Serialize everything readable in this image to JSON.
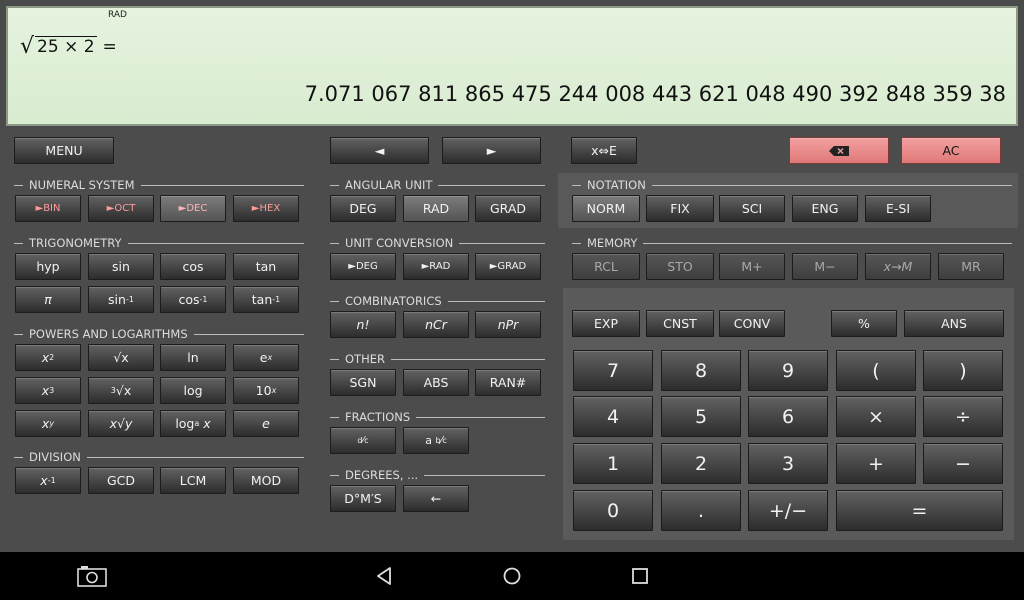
{
  "display": {
    "angle_indicator": "RAD",
    "expression_radicand": "25 × 2",
    "expression_equals": "=",
    "result": "7.071 067 811 865 475 244 008 443 621 048 490 392 848 359 38"
  },
  "top_row": {
    "menu": "MENU",
    "left_arrow": "◄",
    "right_arrow": "►",
    "x_e": "x⇔E",
    "ac": "AC"
  },
  "sections": {
    "numeral_system": "NUMERAL SYSTEM",
    "angular_unit": "ANGULAR UNIT",
    "notation": "NOTATION",
    "trigonometry": "TRIGONOMETRY",
    "unit_conversion": "UNIT CONVERSION",
    "memory": "MEMORY",
    "combinatorics": "COMBINATORICS",
    "powers_logs": "POWERS AND LOGARITHMS",
    "other": "OTHER",
    "fractions": "FRACTIONS",
    "division": "DIVISION",
    "degrees": "DEGREES, ..."
  },
  "numeral": {
    "bin": "►BIN",
    "oct": "►OCT",
    "dec": "►DEC",
    "hex": "►HEX"
  },
  "angular": {
    "deg": "DEG",
    "rad": "RAD",
    "grad": "GRAD"
  },
  "notation": {
    "norm": "NORM",
    "fix": "FIX",
    "sci": "SCI",
    "eng": "ENG",
    "esi": "E-SI"
  },
  "trig": {
    "hyp": "hyp",
    "sin": "sin",
    "cos": "cos",
    "tan": "tan",
    "pi": "π",
    "inv": "-1"
  },
  "unitconv": {
    "deg": "►DEG",
    "rad": "►RAD",
    "grad": "►GRAD"
  },
  "memory": {
    "rcl": "RCL",
    "sto": "STO",
    "mplus": "M+",
    "mminus": "M−",
    "xm": "x→M",
    "mr": "MR"
  },
  "combin": {
    "fact": "n!",
    "ncr": "nCr",
    "npr": "nPr"
  },
  "funcs": {
    "exp": "EXP",
    "cnst": "CNST",
    "conv": "CONV",
    "percent": "%",
    "ans": "ANS"
  },
  "powers": {
    "x": "x",
    "two": "2",
    "three": "3",
    "y": "y",
    "sqrt": "√x",
    "cbrt_idx": "3",
    "cbrt": "√x",
    "yroot": "x√y",
    "ln": "ln",
    "e": "e",
    "log": "log",
    "ten": "10",
    "loga_pre": "log",
    "a": "a",
    "e_const": "e"
  },
  "other": {
    "sgn": "SGN",
    "abs": "ABS",
    "ran": "RAN#"
  },
  "fractions": {
    "d": "d",
    "c": "c",
    "a": "a",
    "b": "b",
    "slash": "⁄"
  },
  "division": {
    "inv": "-1",
    "gcd": "GCD",
    "lcm": "LCM",
    "mod": "MOD"
  },
  "degrees": {
    "dms": "D°M′S",
    "back": "←"
  },
  "numpad": {
    "n7": "7",
    "n8": "8",
    "n9": "9",
    "lparen": "(",
    "rparen": ")",
    "n4": "4",
    "n5": "5",
    "n6": "6",
    "mul": "×",
    "div": "÷",
    "n1": "1",
    "n2": "2",
    "n3": "3",
    "plus": "+",
    "minus": "−",
    "n0": "0",
    "dot": ".",
    "sign": "+/−",
    "equals": "="
  }
}
